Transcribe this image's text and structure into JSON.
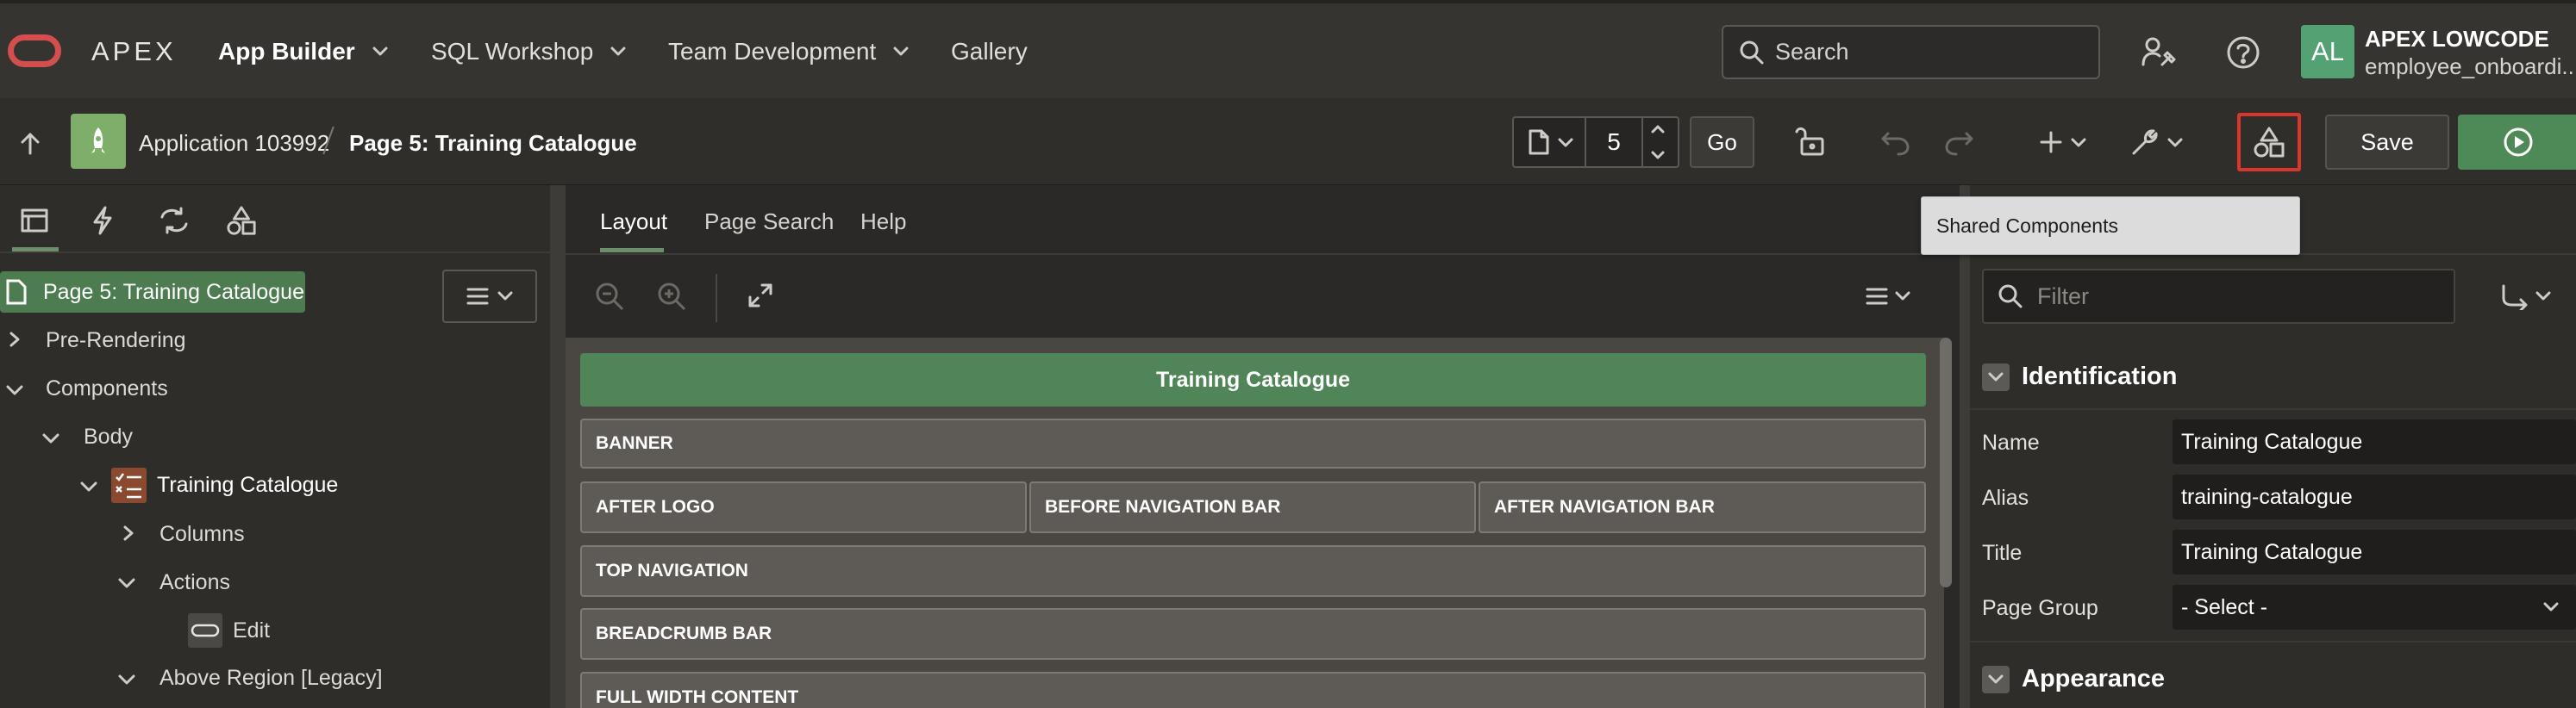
{
  "header": {
    "brand": "APEX",
    "nav": [
      "App Builder",
      "SQL Workshop",
      "Team Development",
      "Gallery"
    ],
    "search_placeholder": "Search",
    "user": {
      "initials": "AL",
      "name": "APEX LOWCODE",
      "workspace": "employee_onboardi..."
    }
  },
  "toolbar": {
    "breadcrumb_app": "Application 103992",
    "breadcrumb_page": "Page 5: Training Catalogue",
    "page_number": "5",
    "go_label": "Go",
    "save_label": "Save",
    "tooltip": "Shared Components"
  },
  "left_tree": {
    "root": "Page 5: Training Catalogue",
    "items": {
      "pre_rendering": "Pre-Rendering",
      "components": "Components",
      "body": "Body",
      "training_catalogue": "Training Catalogue",
      "columns": "Columns",
      "actions": "Actions",
      "edit": "Edit",
      "above_region": "Above Region [Legacy]"
    }
  },
  "center": {
    "tabs": [
      "Layout",
      "Page Search",
      "Help"
    ],
    "title_region": "Training Catalogue",
    "regions": {
      "banner": "BANNER",
      "after_logo": "AFTER LOGO",
      "before_nav": "BEFORE NAVIGATION BAR",
      "after_nav": "AFTER NAVIGATION BAR",
      "top_navigation": "TOP NAVIGATION",
      "breadcrumb_bar": "BREADCRUMB BAR",
      "full_width": "FULL WIDTH CONTENT"
    }
  },
  "right_panel": {
    "filter_placeholder": "Filter",
    "identification": "Identification",
    "appearance": "Appearance",
    "props": {
      "name_label": "Name",
      "name_value": "Training Catalogue",
      "alias_label": "Alias",
      "alias_value": "training-catalogue",
      "title_label": "Title",
      "title_value": "Training Catalogue",
      "group_label": "Page Group",
      "group_value": "- Select -"
    }
  }
}
